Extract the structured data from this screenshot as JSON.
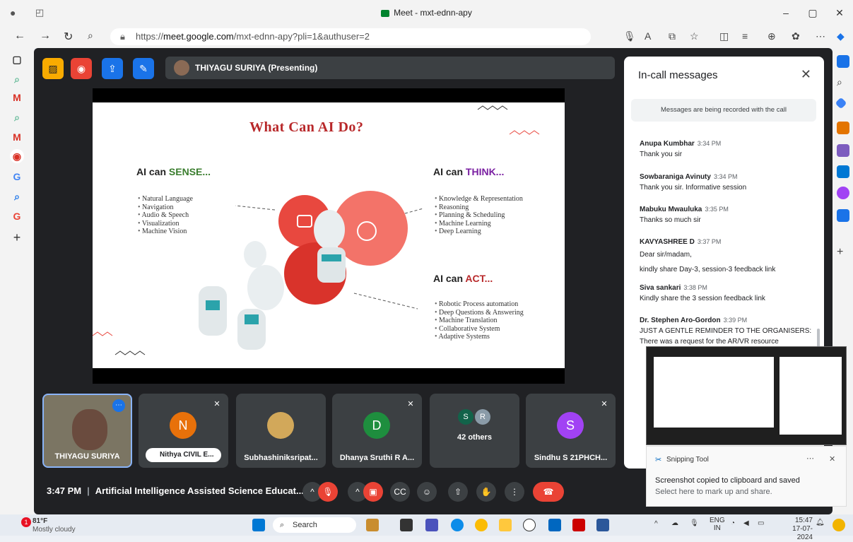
{
  "window": {
    "title": "Meet - mxt-ednn-apy",
    "min": "–",
    "max": "▢",
    "close": "✕"
  },
  "address": {
    "url_prefix": "https://",
    "url_host": "meet.google.com",
    "url_path": "/mxt-ednn-apy?pli=1&authuser=2"
  },
  "meet": {
    "presenter_label": "THIYAGU SURIYA (Presenting)",
    "slide": {
      "title": "What Can AI Do?",
      "sense": {
        "head_pre": "AI can ",
        "head_hl": "SENSE...",
        "items": [
          "Natural Language",
          "Navigation",
          "Audio & Speech",
          "Visualization",
          "Machine Vision"
        ]
      },
      "think": {
        "head_pre": "AI can ",
        "head_hl": "THINK...",
        "items": [
          "Knowledge & Representation",
          "Reasoning",
          "Planning & Scheduling",
          "Machine Learning",
          "Deep Learning"
        ]
      },
      "act": {
        "head_pre": "AI can ",
        "head_hl": "ACT...",
        "items": [
          "Robotic Process automation",
          "Deep Questions & Answering",
          "Machine Translation",
          "Collaborative System",
          "Adaptive Systems"
        ]
      }
    },
    "tiles": [
      {
        "name": "THIYAGU SURIYA",
        "initial": ""
      },
      {
        "name": "Nithya CIVIL E...",
        "initial": "N",
        "color": "#e8710a"
      },
      {
        "name": "Subhashiniksripat...",
        "initial": ""
      },
      {
        "name": "Dhanya Sruthi R A...",
        "initial": "D",
        "color": "#1e8e3e"
      },
      {
        "name": "42 others",
        "initial_a": "S",
        "initial_b": "R"
      },
      {
        "name": "Sindhu S 21PHCH...",
        "initial": "S",
        "color": "#a142f4"
      }
    ],
    "time": "3:47 PM",
    "meeting_name": "Artificial Intelligence Assisted Science Educat...",
    "chat": {
      "title": "In-call messages",
      "recorded_note": "Messages are being recorded with the call",
      "messages": [
        {
          "who": "Anupa Kumbhar",
          "time": "3:34 PM",
          "text": "Thank you sir"
        },
        {
          "who": "Sowbaraniga Avinuty",
          "time": "3:34 PM",
          "text": "Thank you sir. Informative session"
        },
        {
          "who": "Mabuku Mwauluka",
          "time": "3:35 PM",
          "text": "Thanks so much sir"
        },
        {
          "who": "KAVYASHREE D",
          "time": "3:37 PM",
          "text": "Dear sir/madam,\nkindly share Day-3, session-3  feedback link"
        },
        {
          "who": "Siva sankari",
          "time": "3:38 PM",
          "text": "Kindly share the 3 session feedback link"
        },
        {
          "who": "Dr. Stephen Aro-Gordon",
          "time": "3:39 PM",
          "text": "JUST A GENTLE REMINDER TO THE ORGANISERS:\nThere was a request for the AR/VR resource"
        }
      ]
    }
  },
  "snipping": {
    "app": "Snipping Tool",
    "line1": "Screenshot copied to clipboard and saved",
    "line2": "Select here to mark up and share."
  },
  "taskbar": {
    "temp": "81°F",
    "weather": "Mostly cloudy",
    "search": "Search",
    "lang1": "ENG",
    "lang2": "IN",
    "clock": "15:47",
    "date": "17-07-2024",
    "badge": "1"
  }
}
